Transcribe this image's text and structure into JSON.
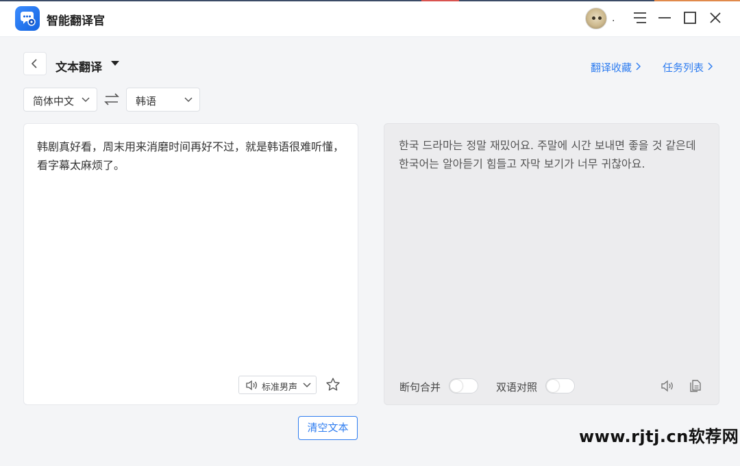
{
  "window": {
    "app_title": "智能翻译官",
    "user_name": ".",
    "icons": [
      "app-logo-icon",
      "menu-icon",
      "minimize-icon",
      "maximize-icon",
      "close-icon"
    ]
  },
  "header": {
    "mode_title": "文本翻译",
    "links": [
      {
        "label": "翻译收藏"
      },
      {
        "label": "任务列表"
      }
    ]
  },
  "languages": {
    "source": "简体中文",
    "target": "韩语"
  },
  "source_panel": {
    "text": "韩剧真好看，周末用来消磨时间再好不过，就是韩语很难听懂，看字幕太麻烦了。",
    "voice": "标准男声"
  },
  "target_panel": {
    "text": "한국 드라마는 정말 재밌어요. 주말에 시간 보내면 좋을 것 같은데 한국어는 알아듣기 힘들고 자막 보기가 너무 귀찮아요.",
    "toggles": [
      {
        "label": "断句合并",
        "on": false
      },
      {
        "label": "双语对照",
        "on": false
      }
    ]
  },
  "actions": {
    "clear_label": "清空文本"
  },
  "watermark": "www.rjtj.cn软荐网",
  "colors": {
    "accent": "#2d7cf0",
    "background": "#f4f5f7",
    "target_panel_bg": "#ececee"
  }
}
